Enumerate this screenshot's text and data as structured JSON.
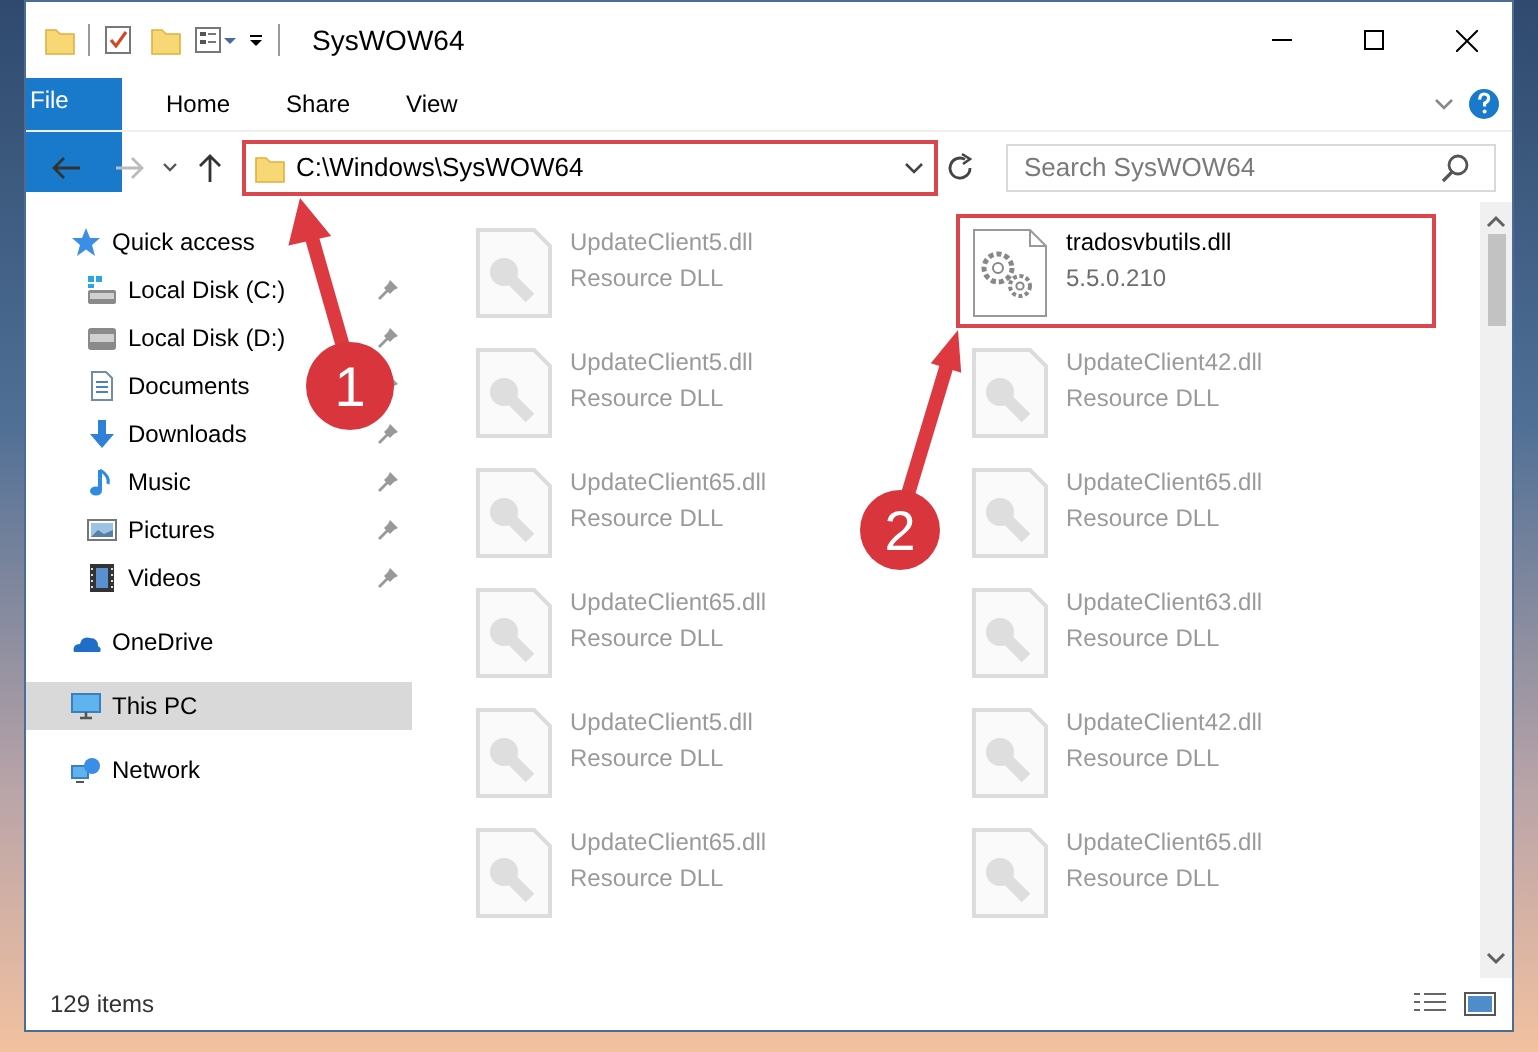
{
  "window": {
    "title": "SysWOW64"
  },
  "ribbon_tabs": [
    {
      "label": "File",
      "kind": "file",
      "selected": false
    },
    {
      "label": "Home",
      "kind": "tab",
      "selected": false
    },
    {
      "label": "Share",
      "kind": "tab",
      "selected": false
    },
    {
      "label": "View",
      "kind": "tab",
      "selected": false
    }
  ],
  "address_bar": {
    "path": "C:\\Windows\\SysWOW64",
    "highlighted": true
  },
  "search": {
    "placeholder": "Search SysWOW64"
  },
  "sidebar": {
    "items": [
      {
        "label": "Quick access",
        "kind": "star",
        "selected": false,
        "children": [
          {
            "label": "Local Disk (C:)",
            "kind": "system-drive",
            "pinned": true,
            "selected": false
          },
          {
            "label": "Local Disk (D:)",
            "kind": "drive",
            "pinned": true,
            "selected": false
          },
          {
            "label": "Documents",
            "kind": "documents",
            "pinned": true,
            "selected": false
          },
          {
            "label": "Downloads",
            "kind": "downloads",
            "pinned": true,
            "selected": false
          },
          {
            "label": "Music",
            "kind": "music",
            "pinned": true,
            "selected": false
          },
          {
            "label": "Pictures",
            "kind": "pictures",
            "pinned": true,
            "selected": false
          },
          {
            "label": "Videos",
            "kind": "videos",
            "pinned": true,
            "selected": false
          }
        ]
      },
      {
        "label": "OneDrive",
        "kind": "cloud",
        "selected": false
      },
      {
        "label": "This PC",
        "kind": "pc",
        "selected": true
      },
      {
        "label": "Network",
        "kind": "network",
        "selected": false
      }
    ]
  },
  "files": [
    {
      "name": "UpdateClient5.dll",
      "detail": "Resource DLL",
      "faded": true,
      "highlighted": false
    },
    {
      "name": "tradosvbutils.dll",
      "detail": "5.5.0.210",
      "faded": false,
      "highlighted": true
    },
    {
      "name": "UpdateClient5.dll",
      "detail": "Resource DLL",
      "faded": true,
      "highlighted": false
    },
    {
      "name": "UpdateClient42.dll",
      "detail": "Resource DLL",
      "faded": true,
      "highlighted": false
    },
    {
      "name": "UpdateClient65.dll",
      "detail": "Resource DLL",
      "faded": true,
      "highlighted": false
    },
    {
      "name": "UpdateClient65.dll",
      "detail": "Resource DLL",
      "faded": true,
      "highlighted": false
    },
    {
      "name": "UpdateClient65.dll",
      "detail": "Resource DLL",
      "faded": true,
      "highlighted": false
    },
    {
      "name": "UpdateClient63.dll",
      "detail": "Resource DLL",
      "faded": true,
      "highlighted": false
    },
    {
      "name": "UpdateClient5.dll",
      "detail": "Resource DLL",
      "faded": true,
      "highlighted": false
    },
    {
      "name": "UpdateClient42.dll",
      "detail": "Resource DLL",
      "faded": true,
      "highlighted": false
    },
    {
      "name": "UpdateClient65.dll",
      "detail": "Resource DLL",
      "faded": true,
      "highlighted": false
    },
    {
      "name": "UpdateClient65.dll",
      "detail": "Resource DLL",
      "faded": true,
      "highlighted": false
    }
  ],
  "callouts": [
    {
      "label": "1"
    },
    {
      "label": "2"
    }
  ],
  "status_bar": {
    "item_count": "129 items"
  }
}
